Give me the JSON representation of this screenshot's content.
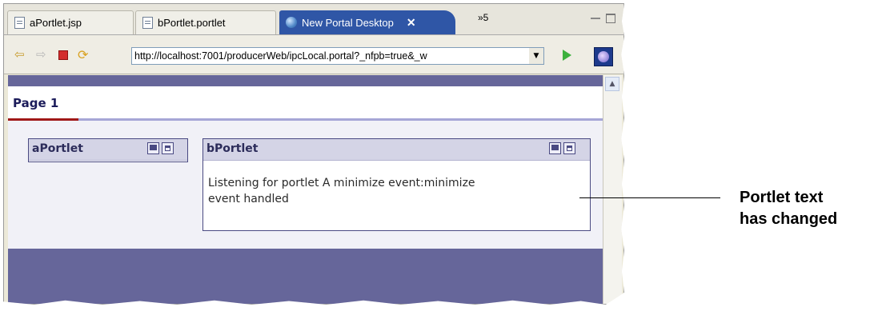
{
  "tabs": [
    {
      "label": "aPortlet.jsp",
      "icon": "jsp-file-icon"
    },
    {
      "label": "bPortlet.portlet",
      "icon": "portlet-file-icon"
    },
    {
      "label": "New Portal Desktop",
      "icon": "globe-icon",
      "active": true,
      "close": "✕"
    }
  ],
  "tab_overflow": "»5",
  "toolbar": {
    "back_icon": "⇦",
    "forward_icon": "⇨",
    "refresh_icon": "⟳",
    "url": "http://localhost:7001/producerWeb/ipcLocal.portal?_nfpb=true&_w",
    "dropdown_icon": "▼"
  },
  "page": {
    "title": "Page 1"
  },
  "portlets": {
    "a": {
      "title": "aPortlet"
    },
    "b": {
      "title": "bPortlet",
      "body_line1": "Listening for portlet A minimize event:minimize",
      "body_line2": "event handled"
    }
  },
  "callout": {
    "line1": "Portlet text",
    "line2": "has changed"
  },
  "colors": {
    "portal_band": "#66669a",
    "active_tab": "#2f56a6",
    "page_accent": "#a01818"
  }
}
